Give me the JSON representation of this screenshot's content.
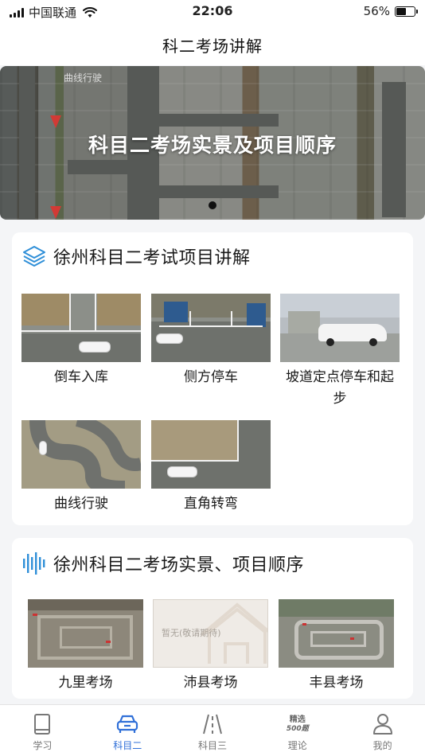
{
  "status_bar": {
    "carrier": "中国联通",
    "time": "22:06",
    "battery": "56%",
    "battery_level": 0.56
  },
  "nav": {
    "title": "科二考场讲解"
  },
  "banner": {
    "title": "科目二考场实景及项目顺序",
    "watermark": "曲线行驶"
  },
  "section_projects": {
    "title": "徐州科目二考试项目讲解",
    "items": [
      {
        "label": "倒车入库"
      },
      {
        "label": "侧方停车"
      },
      {
        "label": "坡道定点停车和起步"
      },
      {
        "label": "曲线行驶"
      },
      {
        "label": "直角转弯"
      }
    ]
  },
  "section_venues": {
    "title": "徐州科目二考场实景、项目顺序",
    "items": [
      {
        "label": "九里考场"
      },
      {
        "label": "沛县考场",
        "placeholder_text": "暂无(敬请期待)"
      },
      {
        "label": "丰县考场"
      }
    ]
  },
  "tabs": [
    {
      "label": "学习",
      "icon": "book-icon",
      "active": false
    },
    {
      "label": "科目二",
      "icon": "car-icon",
      "active": true
    },
    {
      "label": "科目三",
      "icon": "road-icon",
      "active": false
    },
    {
      "label": "理论",
      "icon": "question-bank-icon",
      "active": false,
      "badge_top": "精选",
      "badge_bottom": "500题"
    },
    {
      "label": "我的",
      "icon": "profile-icon",
      "active": false
    }
  ],
  "colors": {
    "accent": "#2f6fd8",
    "banner_arrow": "#d23a35"
  }
}
